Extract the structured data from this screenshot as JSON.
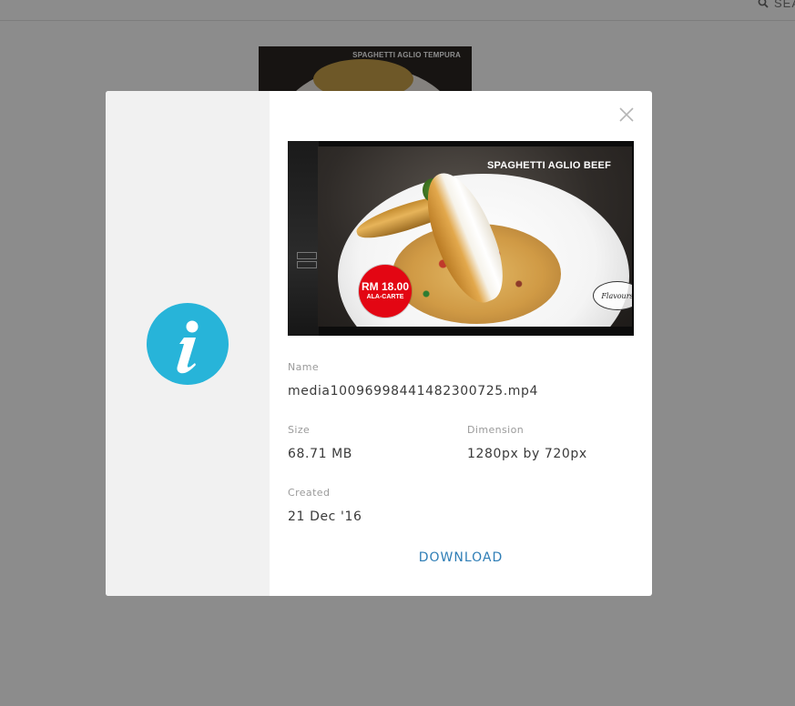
{
  "background": {
    "search_label": "SEA",
    "thumbnail_title": "SPAGHETTI AGLIO TEMPURA"
  },
  "modal": {
    "preview": {
      "title": "SPAGHETTI AGLIO BEEF",
      "price_amount": "RM 18.00",
      "price_sub": "ALA-CARTE",
      "logo_text": "Flavours"
    },
    "fields": {
      "name_label": "Name",
      "name_value": "media10096998441482300725.mp4",
      "size_label": "Size",
      "size_value": "68.71 MB",
      "dimension_label": "Dimension",
      "dimension_value": "1280px by 720px",
      "created_label": "Created",
      "created_value": "21 Dec '16"
    },
    "download_label": "DOWNLOAD"
  },
  "colors": {
    "accent": "#27b4d9",
    "link": "#2f7eb6",
    "price_badge": "#e30613",
    "sidebar": "#f1f1f1"
  },
  "icons": {
    "info": "info-icon",
    "close": "close-icon",
    "search": "search-icon"
  }
}
